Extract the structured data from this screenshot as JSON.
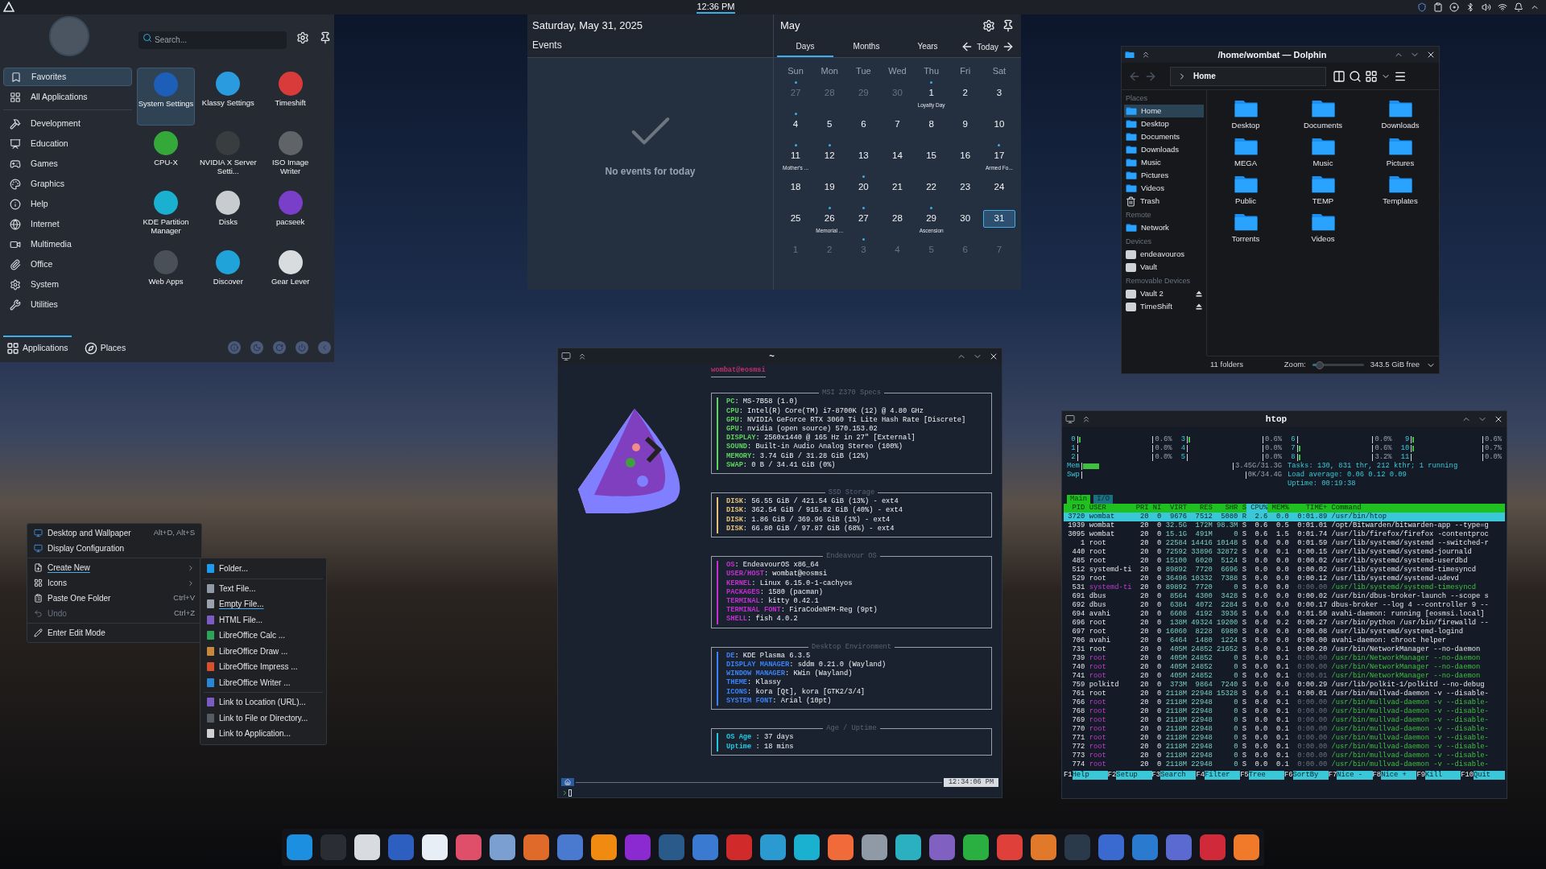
{
  "top_panel": {
    "clock": "12:36 PM"
  },
  "app_menu": {
    "search": {
      "placeholder": "Search..."
    },
    "categories": [
      {
        "label": "Favorites",
        "selected": true
      },
      {
        "label": "All Applications",
        "selected": false
      },
      {
        "label": "Development",
        "selected": false
      },
      {
        "label": "Education",
        "selected": false
      },
      {
        "label": "Games",
        "selected": false
      },
      {
        "label": "Graphics",
        "selected": false
      },
      {
        "label": "Help",
        "selected": false
      },
      {
        "label": "Internet",
        "selected": false
      },
      {
        "label": "Multimedia",
        "selected": false
      },
      {
        "label": "Office",
        "selected": false
      },
      {
        "label": "System",
        "selected": false
      },
      {
        "label": "Utilities",
        "selected": false
      }
    ],
    "apps": [
      {
        "name": "System Settings",
        "selected": true
      },
      {
        "name": "Klassy Settings",
        "selected": false
      },
      {
        "name": "Timeshift",
        "selected": false
      },
      {
        "name": "CPU-X",
        "selected": false
      },
      {
        "name": "NVIDIA X Server Setti...",
        "selected": false
      },
      {
        "name": "ISO Image Writer",
        "selected": false
      },
      {
        "name": "KDE Partition Manager",
        "selected": false
      },
      {
        "name": "Disks",
        "selected": false
      },
      {
        "name": "pacseek",
        "selected": false
      },
      {
        "name": "Web Apps",
        "selected": false
      },
      {
        "name": "Discover",
        "selected": false
      },
      {
        "name": "Gear Lever",
        "selected": false
      }
    ],
    "bottom_tabs": [
      {
        "label": "Applications",
        "selected": true
      },
      {
        "label": "Places",
        "selected": false
      }
    ]
  },
  "calendar": {
    "date": "Saturday, May 31, 2025",
    "events_heading": "Events",
    "empty": "No events for today",
    "month": "May",
    "views": [
      {
        "label": "Days",
        "selected": true
      },
      {
        "label": "Months",
        "selected": false
      },
      {
        "label": "Years",
        "selected": false
      }
    ],
    "today": "Today",
    "weekdays": [
      "Sun",
      "Mon",
      "Tue",
      "Wed",
      "Thu",
      "Fri",
      "Sat"
    ],
    "days": [
      {
        "n": "27",
        "muted": true,
        "dot": true,
        "selected": false
      },
      {
        "n": "28",
        "muted": true,
        "dot": false,
        "selected": false
      },
      {
        "n": "29",
        "muted": true,
        "dot": false,
        "selected": false
      },
      {
        "n": "30",
        "muted": true,
        "dot": false,
        "selected": false
      },
      {
        "n": "1",
        "muted": false,
        "dot": true,
        "selected": false,
        "label": "Loyalty Day"
      },
      {
        "n": "2",
        "muted": false,
        "dot": false,
        "selected": false
      },
      {
        "n": "3",
        "muted": false,
        "dot": false,
        "selected": false
      },
      {
        "n": "4",
        "muted": false,
        "dot": true,
        "selected": false
      },
      {
        "n": "5",
        "muted": false,
        "dot": false,
        "selected": false
      },
      {
        "n": "6",
        "muted": false,
        "dot": false,
        "selected": false
      },
      {
        "n": "7",
        "muted": false,
        "dot": false,
        "selected": false
      },
      {
        "n": "8",
        "muted": false,
        "dot": false,
        "selected": false
      },
      {
        "n": "9",
        "muted": false,
        "dot": false,
        "selected": false
      },
      {
        "n": "10",
        "muted": false,
        "dot": false,
        "selected": false
      },
      {
        "n": "11",
        "muted": false,
        "dot": true,
        "selected": false,
        "label": "Mother's ..."
      },
      {
        "n": "12",
        "muted": false,
        "dot": true,
        "selected": false
      },
      {
        "n": "13",
        "muted": false,
        "dot": false,
        "selected": false
      },
      {
        "n": "14",
        "muted": false,
        "dot": false,
        "selected": false
      },
      {
        "n": "15",
        "muted": false,
        "dot": false,
        "selected": false
      },
      {
        "n": "16",
        "muted": false,
        "dot": false,
        "selected": false
      },
      {
        "n": "17",
        "muted": false,
        "dot": true,
        "selected": false,
        "label": "Armed Fo..."
      },
      {
        "n": "18",
        "muted": false,
        "dot": false,
        "selected": false
      },
      {
        "n": "19",
        "muted": false,
        "dot": false,
        "selected": false
      },
      {
        "n": "20",
        "muted": false,
        "dot": true,
        "selected": false
      },
      {
        "n": "21",
        "muted": false,
        "dot": false,
        "selected": false
      },
      {
        "n": "22",
        "muted": false,
        "dot": false,
        "selected": false
      },
      {
        "n": "23",
        "muted": false,
        "dot": false,
        "selected": false
      },
      {
        "n": "24",
        "muted": false,
        "dot": false,
        "selected": false
      },
      {
        "n": "25",
        "muted": false,
        "dot": false,
        "selected": false
      },
      {
        "n": "26",
        "muted": false,
        "dot": true,
        "selected": false,
        "label": "Memorial ..."
      },
      {
        "n": "27",
        "muted": false,
        "dot": true,
        "selected": false
      },
      {
        "n": "28",
        "muted": false,
        "dot": false,
        "selected": false
      },
      {
        "n": "29",
        "muted": false,
        "dot": true,
        "selected": false,
        "label": "Ascension"
      },
      {
        "n": "30",
        "muted": false,
        "dot": false,
        "selected": false
      },
      {
        "n": "31",
        "muted": false,
        "dot": false,
        "selected": true
      },
      {
        "n": "1",
        "muted": true,
        "dot": false,
        "selected": false
      },
      {
        "n": "2",
        "muted": true,
        "dot": false,
        "selected": false
      },
      {
        "n": "3",
        "muted": true,
        "dot": true,
        "selected": false
      },
      {
        "n": "4",
        "muted": true,
        "dot": false,
        "selected": false
      },
      {
        "n": "5",
        "muted": true,
        "dot": false,
        "selected": false
      },
      {
        "n": "6",
        "muted": true,
        "dot": false,
        "selected": false
      },
      {
        "n": "7",
        "muted": true,
        "dot": false,
        "selected": false
      }
    ]
  },
  "dolphin": {
    "title": "/home/wombat — Dolphin",
    "location": "Home",
    "places": [
      {
        "heading": "Places",
        "items": [
          {
            "label": "Home",
            "kind": "folder",
            "selected": true
          },
          {
            "label": "Desktop",
            "kind": "folder",
            "selected": false
          },
          {
            "label": "Documents",
            "kind": "folder",
            "selected": false
          },
          {
            "label": "Downloads",
            "kind": "folder",
            "selected": false
          },
          {
            "label": "Music",
            "kind": "folder",
            "selected": false
          },
          {
            "label": "Pictures",
            "kind": "folder",
            "selected": false
          },
          {
            "label": "Videos",
            "kind": "folder",
            "selected": false
          },
          {
            "label": "Trash",
            "kind": "trash",
            "selected": false
          }
        ]
      },
      {
        "heading": "Remote",
        "items": [
          {
            "label": "Network",
            "kind": "folder",
            "selected": false
          }
        ]
      },
      {
        "heading": "Devices",
        "items": [
          {
            "label": "endeavouros",
            "kind": "drive",
            "selected": false
          },
          {
            "label": "Vault",
            "kind": "drive",
            "selected": false
          }
        ]
      },
      {
        "heading": "Removable Devices",
        "items": [
          {
            "label": "Vault 2",
            "kind": "drive",
            "selected": false,
            "ejectable": true
          },
          {
            "label": "TimeShift",
            "kind": "drive",
            "selected": false,
            "ejectable": true
          }
        ]
      }
    ],
    "folders": [
      "Desktop",
      "Documents",
      "Downloads",
      "MEGA",
      "Music",
      "Pictures",
      "Public",
      "TEMP",
      "Templates",
      "Torrents",
      "Videos"
    ],
    "status": {
      "count": "11 folders",
      "zoom_label": "Zoom:",
      "zoom": {
        "level": 0.15
      },
      "free": "343.5 GiB free"
    }
  },
  "terminal": {
    "title": "~",
    "user_host": "wombat@eosmsi",
    "sections": [
      {
        "title": "MSI Z370 Specs",
        "color": "#5fd35f",
        "lines": [
          {
            "key": "PC",
            "value": ": MS-7B58 (1.0)"
          },
          {
            "key": "CPU",
            "value": ": Intel(R) Core(TM) i7-8700K (12) @ 4.80 GHz"
          },
          {
            "key": "GPU",
            "value": ": NVIDIA GeForce RTX 3060 Ti Lite Hash Rate [Discrete]"
          },
          {
            "key": "GPU",
            "value": ": nvidia (open source) 570.153.02"
          },
          {
            "key": "DISPLAY",
            "value": ": 2560x1440 @ 165 Hz in 27\" [External]"
          },
          {
            "key": "SOUND",
            "value": ": Built-in Audio Analog Stereo (100%)"
          },
          {
            "key": "MEMORY",
            "value": ": 3.74 GiB / 31.28 GiB (12%)"
          },
          {
            "key": "SWAP",
            "value": ": 0 B / 34.41 GiB (0%)"
          }
        ]
      },
      {
        "title": "SSD Storage",
        "color": "#e5c07b",
        "lines": [
          {
            "key": "DISK",
            "value": ": 56.55 GiB / 421.54 GiB (13%) - ext4"
          },
          {
            "key": "DISK",
            "value": ": 362.54 GiB / 915.82 GiB (40%) - ext4"
          },
          {
            "key": "DISK",
            "value": ": 1.86 GiB / 369.96 GiB (1%) - ext4"
          },
          {
            "key": "DISK",
            "value": ": 66.80 GiB / 97.87 GiB (68%) - ext4"
          }
        ]
      },
      {
        "title": "Endeavour OS",
        "color": "#c22fd0",
        "lines": [
          {
            "key": "OS",
            "value": ": EndeavourOS x86_64"
          },
          {
            "key": "USER/HOST",
            "value": ": wombat@eosmsi"
          },
          {
            "key": "KERNEL",
            "value": ": Linux 6.15.0-1-cachyos"
          },
          {
            "key": "PACKAGES",
            "value": ": 1580 (pacman)"
          },
          {
            "key": "TERMINAL",
            "value": ": kitty 0.42.1"
          },
          {
            "key": "TERMINAL FONT",
            "value": ": FiraCodeNFM-Reg (9pt)"
          },
          {
            "key": "SHELL",
            "value": ": fish 4.0.2"
          }
        ]
      },
      {
        "title": "Desktop Environment",
        "color": "#3b82f6",
        "lines": [
          {
            "key": "DE",
            "value": ": KDE Plasma 6.3.5"
          },
          {
            "key": "DISPLAY MANAGER",
            "value": ": sddm 0.21.0 (Wayland)"
          },
          {
            "key": "WINDOW MANAGER",
            "value": ": KWin (Wayland)"
          },
          {
            "key": "THEME",
            "value": ": Klassy"
          },
          {
            "key": "ICONS",
            "value": ": kora [Qt], kora [GTK2/3/4]"
          },
          {
            "key": "SYSTEM FONT",
            "value": ": Arial (10pt)"
          }
        ]
      },
      {
        "title": "Age / Uptime",
        "color": "#22c7e0",
        "lines": [
          {
            "key": "OS Age",
            "value": " : 37 days"
          },
          {
            "key": "Uptime",
            "value": " : 18 mins"
          }
        ]
      }
    ],
    "prompt_time": "12:34:06 PM"
  },
  "htop": {
    "title": "htop",
    "cpus": [
      {
        "label": "0",
        "reading": "0.6%",
        "level": 0.006
      },
      {
        "label": "1",
        "reading": "0.0%",
        "level": 0
      },
      {
        "label": "2",
        "reading": "0.0%",
        "level": 0
      },
      {
        "label": "3",
        "reading": "0.6%",
        "level": 0.006
      },
      {
        "label": "4",
        "reading": "0.0%",
        "level": 0
      },
      {
        "label": "5",
        "reading": "0.0%",
        "level": 0
      },
      {
        "label": "6",
        "reading": "0.0%",
        "level": 0
      },
      {
        "label": "7",
        "reading": "0.6%",
        "level": 0.006
      },
      {
        "label": "8",
        "reading": "3.2%",
        "level": 0.032
      },
      {
        "label": "9",
        "reading": "0.6%",
        "level": 0.006
      },
      {
        "label": "10",
        "reading": "0.7%",
        "level": 0.007
      },
      {
        "label": "11",
        "reading": "0.0%",
        "level": 0
      }
    ],
    "mem": {
      "label": "Mem",
      "reading": "3.45G/31.3G",
      "level": 0.11
    },
    "swap": {
      "label": "Swp",
      "reading": "0K/34.4G",
      "level": 0
    },
    "tasks": "Tasks: 130, 831 thr, 212 kthr; 1 running",
    "load": "Load average: 0.06 0.12 0.09",
    "uptime": "Uptime: 00:19:38",
    "tabs": [
      {
        "label": "Main",
        "selected": true
      },
      {
        "label": "I/O",
        "selected": false
      }
    ],
    "columns": [
      {
        "label": "PID",
        "sorted": false
      },
      {
        "label": "USER",
        "sorted": false
      },
      {
        "label": "PRI",
        "sorted": false
      },
      {
        "label": "NI",
        "sorted": false
      },
      {
        "label": "VIRT",
        "sorted": false
      },
      {
        "label": "RES",
        "sorted": false
      },
      {
        "label": "SHR",
        "sorted": false
      },
      {
        "label": "S",
        "sorted": false
      },
      {
        "label": "CPU%",
        "sorted": true
      },
      {
        "label": "MEM%",
        "sorted": false
      },
      {
        "label": "TIME+",
        "sorted": false
      },
      {
        "label": "Command",
        "sorted": false
      }
    ],
    "rows": [
      {
        "cells": [
          "3720",
          "wombat",
          "20",
          "0",
          "9676",
          "7512",
          "5080",
          "R",
          "2.6",
          "0.0",
          "0:01.89",
          "/usr/bin/htop"
        ],
        "selected": true,
        "thread": false
      },
      {
        "cells": [
          "1939",
          "wombat",
          "20",
          "0",
          "32.5G",
          "172M",
          "98.3M",
          "S",
          "0.6",
          "0.5",
          "0:01.01",
          "/opt/Bitwarden/bitwarden-app --type=g"
        ],
        "selected": false,
        "thread": false
      },
      {
        "cells": [
          "3095",
          "wombat",
          "20",
          "0",
          "15.1G",
          "491M",
          "0",
          "S",
          "0.6",
          "1.5",
          "0:01.74",
          "/usr/lib/firefox/firefox -contentproc"
        ],
        "selected": false,
        "thread": false
      },
      {
        "cells": [
          "1",
          "root",
          "20",
          "0",
          "22584",
          "14416",
          "10148",
          "S",
          "0.0",
          "0.0",
          "0:01.59",
          "/usr/lib/systemd/systemd --switched-r"
        ],
        "selected": false,
        "thread": false
      },
      {
        "cells": [
          "440",
          "root",
          "20",
          "0",
          "72592",
          "33896",
          "32872",
          "S",
          "0.0",
          "0.1",
          "0:00.15",
          "/usr/lib/systemd/systemd-journald"
        ],
        "selected": false,
        "thread": false
      },
      {
        "cells": [
          "485",
          "root",
          "20",
          "0",
          "15100",
          "6020",
          "5124",
          "S",
          "0.0",
          "0.0",
          "0:00.02",
          "/usr/lib/systemd/systemd-userdbd"
        ],
        "selected": false,
        "thread": false
      },
      {
        "cells": [
          "512",
          "systemd-ti",
          "20",
          "0",
          "89892",
          "7720",
          "6696",
          "S",
          "0.0",
          "0.0",
          "0:00.02",
          "/usr/lib/systemd/systemd-timesyncd"
        ],
        "selected": false,
        "thread": false
      },
      {
        "cells": [
          "529",
          "root",
          "20",
          "0",
          "36496",
          "10332",
          "7388",
          "S",
          "0.0",
          "0.0",
          "0:00.12",
          "/usr/lib/systemd/systemd-udevd"
        ],
        "selected": false,
        "thread": false
      },
      {
        "cells": [
          "531",
          "systemd-ti",
          "20",
          "0",
          "89892",
          "7720",
          "0",
          "S",
          "0.0",
          "0.0",
          "0:00.00",
          "/usr/lib/systemd/systemd-timesyncd"
        ],
        "selected": false,
        "thread": true
      },
      {
        "cells": [
          "691",
          "dbus",
          "20",
          "0",
          "8564",
          "4300",
          "3428",
          "S",
          "0.0",
          "0.0",
          "0:00.02",
          "/usr/bin/dbus-broker-launch --scope s"
        ],
        "selected": false,
        "thread": false
      },
      {
        "cells": [
          "692",
          "dbus",
          "20",
          "0",
          "6384",
          "4072",
          "2284",
          "S",
          "0.0",
          "0.0",
          "0:00.17",
          "dbus-broker --log 4 --controller 9 --"
        ],
        "selected": false,
        "thread": false
      },
      {
        "cells": [
          "694",
          "avahi",
          "20",
          "0",
          "6608",
          "4192",
          "3936",
          "S",
          "0.0",
          "0.0",
          "0:01.50",
          "avahi-daemon: running [eosmsi.local]"
        ],
        "selected": false,
        "thread": false
      },
      {
        "cells": [
          "696",
          "root",
          "20",
          "0",
          "138M",
          "49324",
          "19200",
          "S",
          "0.0",
          "0.2",
          "0:00.27",
          "/usr/bin/python /usr/bin/firewalld --"
        ],
        "selected": false,
        "thread": false
      },
      {
        "cells": [
          "697",
          "root",
          "20",
          "0",
          "16060",
          "8228",
          "6980",
          "S",
          "0.0",
          "0.0",
          "0:00.08",
          "/usr/lib/systemd/systemd-logind"
        ],
        "selected": false,
        "thread": false
      },
      {
        "cells": [
          "706",
          "avahi",
          "20",
          "0",
          "6464",
          "1480",
          "1224",
          "S",
          "0.0",
          "0.0",
          "0:00.00",
          "avahi-daemon: chroot helper"
        ],
        "selected": false,
        "thread": false
      },
      {
        "cells": [
          "731",
          "root",
          "20",
          "0",
          "405M",
          "24852",
          "21652",
          "S",
          "0.0",
          "0.1",
          "0:00.20",
          "/usr/bin/NetworkManager --no-daemon"
        ],
        "selected": false,
        "thread": false
      },
      {
        "cells": [
          "739",
          "root",
          "20",
          "0",
          "405M",
          "24852",
          "0",
          "S",
          "0.0",
          "0.1",
          "0:00.00",
          "/usr/bin/NetworkManager --no-daemon"
        ],
        "selected": false,
        "thread": true
      },
      {
        "cells": [
          "740",
          "root",
          "20",
          "0",
          "405M",
          "24852",
          "0",
          "S",
          "0.0",
          "0.1",
          "0:00.00",
          "/usr/bin/NetworkManager --no-daemon"
        ],
        "selected": false,
        "thread": true
      },
      {
        "cells": [
          "741",
          "root",
          "20",
          "0",
          "405M",
          "24852",
          "0",
          "S",
          "0.0",
          "0.1",
          "0:00.01",
          "/usr/bin/NetworkManager --no-daemon"
        ],
        "selected": false,
        "thread": true
      },
      {
        "cells": [
          "759",
          "polkitd",
          "20",
          "0",
          "373M",
          "9864",
          "7240",
          "S",
          "0.0",
          "0.0",
          "0:00.29",
          "/usr/lib/polkit-1/polkitd --no-debug"
        ],
        "selected": false,
        "thread": false
      },
      {
        "cells": [
          "761",
          "root",
          "20",
          "0",
          "2118M",
          "22948",
          "15328",
          "S",
          "0.0",
          "0.1",
          "0:00.01",
          "/usr/bin/mullvad-daemon -v --disable-"
        ],
        "selected": false,
        "thread": false
      },
      {
        "cells": [
          "766",
          "root",
          "20",
          "0",
          "2118M",
          "22948",
          "0",
          "S",
          "0.0",
          "0.1",
          "0:00.00",
          "/usr/bin/mullvad-daemon -v --disable-"
        ],
        "selected": false,
        "thread": true
      },
      {
        "cells": [
          "768",
          "root",
          "20",
          "0",
          "2118M",
          "22948",
          "0",
          "S",
          "0.0",
          "0.1",
          "0:00.00",
          "/usr/bin/mullvad-daemon -v --disable-"
        ],
        "selected": false,
        "thread": true
      },
      {
        "cells": [
          "769",
          "root",
          "20",
          "0",
          "2118M",
          "22948",
          "0",
          "S",
          "0.0",
          "0.1",
          "0:00.00",
          "/usr/bin/mullvad-daemon -v --disable-"
        ],
        "selected": false,
        "thread": true
      },
      {
        "cells": [
          "770",
          "root",
          "20",
          "0",
          "2118M",
          "22948",
          "0",
          "S",
          "0.0",
          "0.1",
          "0:00.00",
          "/usr/bin/mullvad-daemon -v --disable-"
        ],
        "selected": false,
        "thread": true
      },
      {
        "cells": [
          "771",
          "root",
          "20",
          "0",
          "2118M",
          "22948",
          "0",
          "S",
          "0.0",
          "0.1",
          "0:00.00",
          "/usr/bin/mullvad-daemon -v --disable-"
        ],
        "selected": false,
        "thread": true
      },
      {
        "cells": [
          "772",
          "root",
          "20",
          "0",
          "2118M",
          "22948",
          "0",
          "S",
          "0.0",
          "0.1",
          "0:00.00",
          "/usr/bin/mullvad-daemon -v --disable-"
        ],
        "selected": false,
        "thread": true
      },
      {
        "cells": [
          "773",
          "root",
          "20",
          "0",
          "2118M",
          "22948",
          "0",
          "S",
          "0.0",
          "0.1",
          "0:00.00",
          "/usr/bin/mullvad-daemon -v --disable-"
        ],
        "selected": false,
        "thread": true
      },
      {
        "cells": [
          "774",
          "root",
          "20",
          "0",
          "2118M",
          "22948",
          "0",
          "S",
          "0.0",
          "0.1",
          "0:00.00",
          "/usr/bin/mullvad-daemon -v --disable-"
        ],
        "selected": false,
        "thread": true
      }
    ],
    "keys": [
      {
        "key": "F1",
        "label": "Help"
      },
      {
        "key": "F2",
        "label": "Setup"
      },
      {
        "key": "F3",
        "label": "Search"
      },
      {
        "key": "F4",
        "label": "Filter"
      },
      {
        "key": "F5",
        "label": "Tree"
      },
      {
        "key": "F6",
        "label": "SortBy"
      },
      {
        "key": "F7",
        "label": "Nice -"
      },
      {
        "key": "F8",
        "label": "Nice +"
      },
      {
        "key": "F9",
        "label": "Kill"
      },
      {
        "key": "F10",
        "label": "Quit"
      }
    ]
  },
  "context_menu": {
    "groups": [
      [
        {
          "label": "Desktop and Wallpaper",
          "shortcut": "Alt+D, Alt+S",
          "disabled": false,
          "submenu": false,
          "selected": false
        },
        {
          "label": "Display Configuration",
          "disabled": false,
          "submenu": false,
          "selected": false
        }
      ],
      [
        {
          "label": "Create New",
          "disabled": false,
          "submenu": true,
          "selected": true
        },
        {
          "label": "Icons",
          "disabled": false,
          "submenu": true,
          "selected": false
        },
        {
          "label": "Paste One Folder",
          "shortcut": "Ctrl+V",
          "disabled": false,
          "submenu": false,
          "selected": false
        },
        {
          "label": "Undo",
          "shortcut": "Ctrl+Z",
          "disabled": true,
          "submenu": false,
          "selected": false
        }
      ],
      [
        {
          "label": "Enter Edit Mode",
          "disabled": false,
          "submenu": false,
          "selected": false
        }
      ]
    ],
    "submenu": [
      [
        {
          "label": "Folder...",
          "color": "#1d9bf0",
          "selected": false
        }
      ],
      [
        {
          "label": "Text File...",
          "color": "#8f9aa6",
          "selected": false
        },
        {
          "label": "Empty File...",
          "color": "#9aa3ad",
          "selected": true
        },
        {
          "label": "HTML File...",
          "color": "#7c5cc4",
          "selected": false
        },
        {
          "label": "LibreOffice Calc ...",
          "color": "#2fa35a",
          "selected": false
        },
        {
          "label": "LibreOffice Draw ...",
          "color": "#c9873a",
          "selected": false
        },
        {
          "label": "LibreOffice Impress ...",
          "color": "#d9502c",
          "selected": false
        },
        {
          "label": "LibreOffice Writer ...",
          "color": "#2a86d6",
          "selected": false
        }
      ],
      [
        {
          "label": "Link to Location (URL)...",
          "color": "#7c5cc4",
          "selected": false
        },
        {
          "label": "Link to File or Directory...",
          "color": "#555b63",
          "selected": false
        },
        {
          "label": "Link to Application...",
          "color": "#d0d0d0",
          "selected": false
        }
      ]
    ]
  }
}
